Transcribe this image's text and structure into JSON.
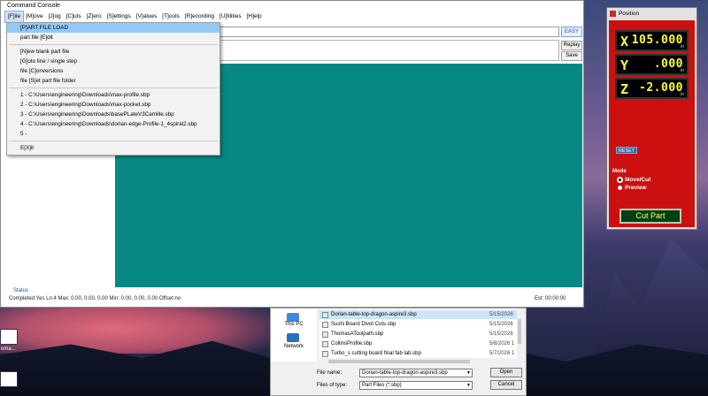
{
  "console": {
    "title": "Command Console",
    "menu": [
      "[F]ile",
      "[M]ove",
      "[J]og",
      "[C]uts",
      "[Z]ero",
      "[S]ettings",
      "[V]alues",
      "[T]ools",
      "[R]ecording",
      "[U]tilities",
      "[H]elp"
    ],
    "easy_label": "EASY",
    "replay_label": "Replay",
    "save_label": "Save",
    "status_label": "Status",
    "status_line": "Completed:Yes Ln:4 Max: 0.00, 0.00, 0.00   Min: 0.00, 0.00, 0.00   Offset:no",
    "est": "Est: 00:00:00"
  },
  "file_menu": {
    "items": [
      "[P]ART FILE LOAD",
      "part file [E]dit",
      "[N]ew blank part file",
      "[G]oto line / single step",
      "file [C]onversions",
      "file [S]et part file folder",
      "1 - C:\\Users\\engineering\\Downloads\\max-profile.sbp",
      "2 - C:\\Users\\engineering\\Downloads\\max-pocket.sbp",
      "3 - C:\\Users\\engineering\\Downloads\\basePLateV3Camille.sbp",
      "4 - C:\\Users\\engineering\\Downloads\\dorian-edge-Profile-1_4spiral2.sbp",
      "5 -",
      "E[X]it"
    ],
    "highlighted": "[P]ART FILE LOAD"
  },
  "open_dialog": {
    "nav": [
      "This PC",
      "Network"
    ],
    "files": [
      {
        "name": "Dorian-table-top-dragon-aspire3.sbp",
        "date": "5/15/2026"
      },
      {
        "name": "Sushi Board Divot Cuts.sbp",
        "date": "5/15/2026"
      },
      {
        "name": "ThomasAToolpath.sbp",
        "date": "5/15/2026"
      },
      {
        "name": "CollinsProfile.sbp",
        "date": "5/8/2026 1"
      },
      {
        "name": "Turbo_s cutting board final fab lab.sbp",
        "date": "5/7/2026 1"
      }
    ],
    "file_name_label": "File name:",
    "file_name_value": "Dorian-table-top-dragon-aspire3.sbp",
    "file_type_label": "Files of type:",
    "file_type_value": "Part Files (*.sbp)",
    "open_label": "Open",
    "cancel_label": "Cancel"
  },
  "position": {
    "title": "Position",
    "axes": [
      {
        "axis": "X",
        "value": "105.000",
        "unit": "in"
      },
      {
        "axis": "Y",
        "value": ".000",
        "unit": "in"
      },
      {
        "axis": "Z",
        "value": "-2.000",
        "unit": "in"
      }
    ],
    "reset_label": "RESET",
    "mode_label": "Mode",
    "modes": [
      "Move/Cut",
      "Preview"
    ],
    "selected_mode": "Move/Cut",
    "cut_part_label": "Cut Part"
  },
  "desktop": {
    "icon_label": "oma..."
  },
  "colors": {
    "teal": "#078882",
    "position_red": "#cc1010",
    "readout_yellow": "#ffff33",
    "menu_highlight": "#91c9f7"
  }
}
